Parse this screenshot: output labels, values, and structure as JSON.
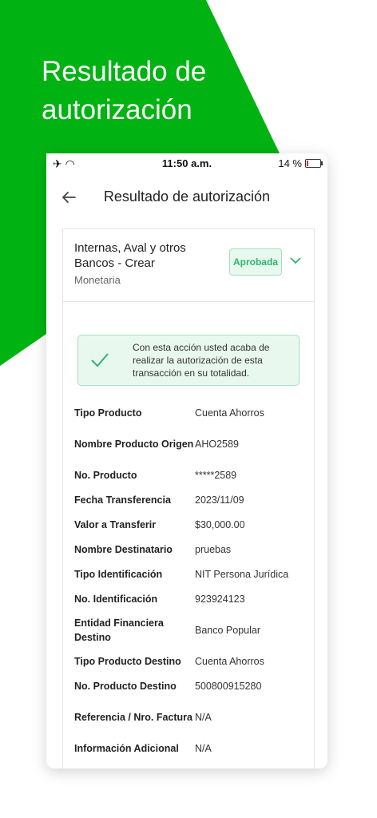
{
  "hero": {
    "title": "Resultado de autorización"
  },
  "status_bar": {
    "time": "11:50 a.m.",
    "battery": "14 %",
    "battery_level": 0.14
  },
  "header": {
    "title": "Resultado de autorización"
  },
  "item": {
    "title": "Internas, Aval y otros Bancos - Crear",
    "subtitle": "Monetaria",
    "badge": "Aprobada"
  },
  "alert": {
    "text": "Con esta acción usted acaba de realizar la autorización de esta transacción en su totalidad."
  },
  "colors": {
    "brand_green": "#00b312",
    "approved_text": "#2cb56c",
    "approved_bg": "#e7f8ee"
  },
  "details": [
    {
      "label": "Tipo Producto",
      "value": "Cuenta Ahorros"
    },
    {
      "label": "Nombre Producto Origen",
      "value": "AHO2589"
    },
    {
      "label": "No. Producto",
      "value": "*****2589"
    },
    {
      "label": "Fecha Transferencia",
      "value": "2023/11/09"
    },
    {
      "label": "Valor a Transferir",
      "value": "$30,000.00"
    },
    {
      "label": "Nombre Destinatario",
      "value": "pruebas"
    },
    {
      "label": "Tipo Identificación",
      "value": "NIT Persona Jurídica"
    },
    {
      "label": "No. Identificación",
      "value": "923924123"
    },
    {
      "label": "Entidad Financiera Destino",
      "value": "Banco Popular"
    },
    {
      "label": "Tipo Producto Destino",
      "value": "Cuenta Ahorros"
    },
    {
      "label": "No. Producto Destino",
      "value": "500800915280"
    },
    {
      "label": "Referencia / Nro. Factura",
      "value": "N/A"
    },
    {
      "label": "Información Adicional",
      "value": "N/A"
    }
  ]
}
